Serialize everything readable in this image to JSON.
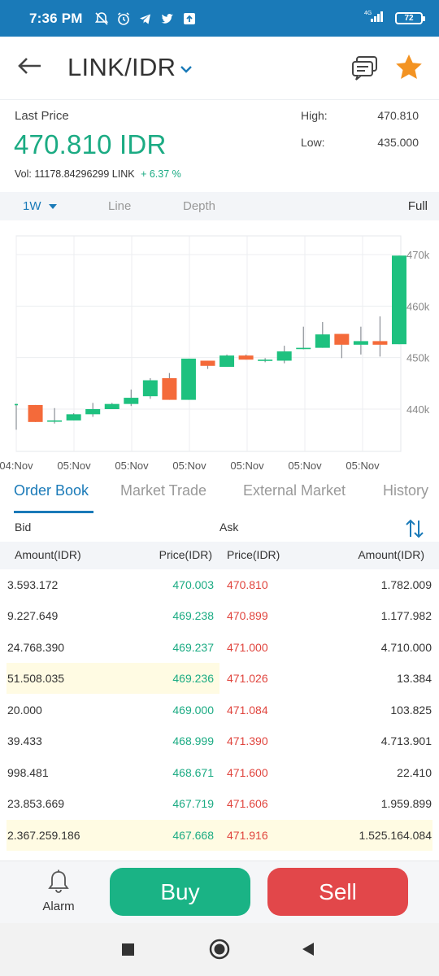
{
  "status_bar": {
    "time": "7:36 PM",
    "network": "4G",
    "battery": "72"
  },
  "header": {
    "title": "LINK/IDR"
  },
  "ticker": {
    "last_price_label": "Last Price",
    "last_price": "470.810 IDR",
    "volume": "Vol:  11178.84296299 LINK",
    "change": "+ 6.37 %",
    "high_label": "High:",
    "high_value": "470.810",
    "low_label": "Low:",
    "low_value": "435.000"
  },
  "chart_toolbar": {
    "period": "1W",
    "line": "Line",
    "depth": "Depth",
    "full": "Full"
  },
  "chart_data": {
    "type": "candlestick",
    "y_ticks": [
      "470k",
      "460k",
      "450k",
      "440k"
    ],
    "x_ticks": [
      "04:Nov",
      "05:Nov",
      "05:Nov",
      "05:Nov",
      "05:Nov",
      "05:Nov",
      "05:Nov"
    ],
    "ylim": [
      434000,
      473000
    ],
    "up_color": "#1ec17f",
    "down_color": "#f46a3a",
    "candles": [
      {
        "o": 441000,
        "c": 441000,
        "h": 441000,
        "l": 436000
      },
      {
        "o": 440800,
        "c": 437500,
        "h": 440800,
        "l": 437500
      },
      {
        "o": 437600,
        "c": 437800,
        "h": 440200,
        "l": 437200
      },
      {
        "o": 437800,
        "c": 439000,
        "h": 439200,
        "l": 437800
      },
      {
        "o": 439000,
        "c": 440000,
        "h": 441200,
        "l": 438500
      },
      {
        "o": 440000,
        "c": 441000,
        "h": 441200,
        "l": 440000
      },
      {
        "o": 441000,
        "c": 442200,
        "h": 443800,
        "l": 440600
      },
      {
        "o": 442500,
        "c": 445600,
        "h": 446000,
        "l": 442000
      },
      {
        "o": 446000,
        "c": 441800,
        "h": 447000,
        "l": 441800
      },
      {
        "o": 441800,
        "c": 449800,
        "h": 449800,
        "l": 441800
      },
      {
        "o": 449400,
        "c": 448400,
        "h": 449400,
        "l": 447800
      },
      {
        "o": 448200,
        "c": 450400,
        "h": 450600,
        "l": 448200
      },
      {
        "o": 450400,
        "c": 449600,
        "h": 450600,
        "l": 449600
      },
      {
        "o": 449600,
        "c": 449600,
        "h": 449900,
        "l": 449100
      },
      {
        "o": 449400,
        "c": 451200,
        "h": 452300,
        "l": 448900
      },
      {
        "o": 451700,
        "c": 451900,
        "h": 456000,
        "l": 451600
      },
      {
        "o": 451900,
        "c": 454500,
        "h": 456900,
        "l": 451900
      },
      {
        "o": 454600,
        "c": 452500,
        "h": 454600,
        "l": 449900
      },
      {
        "o": 452500,
        "c": 453200,
        "h": 456000,
        "l": 450600
      },
      {
        "o": 453200,
        "c": 452500,
        "h": 458000,
        "l": 450200
      },
      {
        "o": 452600,
        "c": 469800,
        "h": 469800,
        "l": 452600
      }
    ]
  },
  "tabs": [
    "Order Book",
    "Market Trade",
    "External Market",
    "History"
  ],
  "order_book": {
    "bid_label": "Bid",
    "ask_label": "Ask",
    "headers": {
      "bid_amount": "Amount(IDR)",
      "bid_price": "Price(IDR)",
      "ask_price": "Price(IDR)",
      "ask_amount": "Amount(IDR)"
    },
    "rows": [
      {
        "bid_amount": "3.593.172",
        "bid_price": "470.003",
        "ask_price": "470.810",
        "ask_amount": "1.782.009",
        "highlight_bid": false,
        "highlight_ask": false
      },
      {
        "bid_amount": "9.227.649",
        "bid_price": "469.238",
        "ask_price": "470.899",
        "ask_amount": "1.177.982",
        "highlight_bid": false,
        "highlight_ask": false
      },
      {
        "bid_amount": "24.768.390",
        "bid_price": "469.237",
        "ask_price": "471.000",
        "ask_amount": "4.710.000",
        "highlight_bid": false,
        "highlight_ask": false
      },
      {
        "bid_amount": "51.508.035",
        "bid_price": "469.236",
        "ask_price": "471.026",
        "ask_amount": "13.384",
        "highlight_bid": true,
        "highlight_ask": false
      },
      {
        "bid_amount": "20.000",
        "bid_price": "469.000",
        "ask_price": "471.084",
        "ask_amount": "103.825",
        "highlight_bid": false,
        "highlight_ask": false
      },
      {
        "bid_amount": "39.433",
        "bid_price": "468.999",
        "ask_price": "471.390",
        "ask_amount": "4.713.901",
        "highlight_bid": false,
        "highlight_ask": false
      },
      {
        "bid_amount": "998.481",
        "bid_price": "468.671",
        "ask_price": "471.600",
        "ask_amount": "22.410",
        "highlight_bid": false,
        "highlight_ask": false
      },
      {
        "bid_amount": "23.853.669",
        "bid_price": "467.719",
        "ask_price": "471.606",
        "ask_amount": "1.959.899",
        "highlight_bid": false,
        "highlight_ask": false
      },
      {
        "bid_amount": "2.367.259.186",
        "bid_price": "467.668",
        "ask_price": "471.916",
        "ask_amount": "1.525.164.084",
        "highlight_bid": true,
        "highlight_ask": true
      }
    ]
  },
  "actions": {
    "alarm_label": "Alarm",
    "buy_label": "Buy",
    "sell_label": "Sell"
  },
  "colors": {
    "brand": "#1a7ab8",
    "positive": "#1bab83",
    "negative": "#e0443d",
    "star": "#f39322"
  }
}
